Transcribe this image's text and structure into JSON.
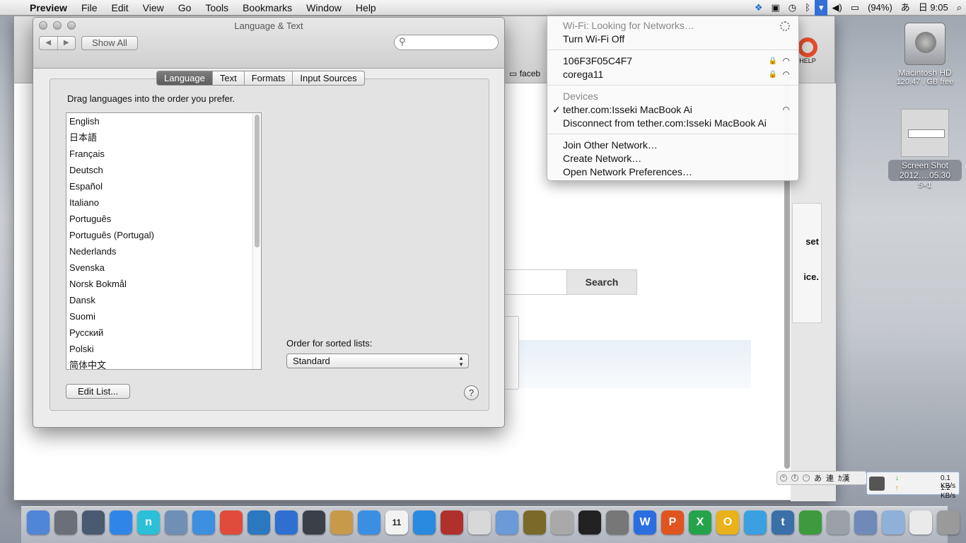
{
  "menubar": {
    "app_name": "Preview",
    "menus": [
      "File",
      "Edit",
      "View",
      "Go",
      "Tools",
      "Bookmarks",
      "Window",
      "Help"
    ],
    "battery": "(94%)",
    "ime": "あ",
    "clock": "日 9:05"
  },
  "desktop": {
    "hd_name": "Macintosh HD",
    "hd_free": "120.47 . GB free",
    "shot_name1": "Screen Shot",
    "shot_name2": "2012….05.30",
    "shot_dim": "5×1"
  },
  "browser": {
    "bookmark_folder": "faceb",
    "help_label": "HELP",
    "side_text1": "set",
    "side_text2": "ice.",
    "search_button": "Search"
  },
  "prefs": {
    "title": "Language & Text",
    "show_all": "Show All",
    "tabs": [
      "Language",
      "Text",
      "Formats",
      "Input Sources"
    ],
    "instructions": "Drag languages into the order you prefer.",
    "languages": [
      "English",
      "日本語",
      "Français",
      "Deutsch",
      "Español",
      "Italiano",
      "Português",
      "Português (Portugal)",
      "Nederlands",
      "Svenska",
      "Norsk Bokmål",
      "Dansk",
      "Suomi",
      "Русский",
      "Polski",
      "简体中文"
    ],
    "order_label": "Order for sorted lists:",
    "order_value": "Standard",
    "edit_list": "Edit List...",
    "help": "?"
  },
  "wifi_menu": {
    "status": "Wi-Fi: Looking for Networks…",
    "toggle": "Turn Wi-Fi Off",
    "networks": [
      "106F3F05C4F7",
      "corega11"
    ],
    "devices_header": "Devices",
    "device": "tether.com:Isseki MacBook Ai",
    "disconnect": "Disconnect from tether.com:Isseki MacBook Ai",
    "join_other": "Join Other Network…",
    "create": "Create Network…",
    "open_prefs": "Open Network Preferences…"
  },
  "ime_bar": {
    "label1": "あ",
    "label2": "連",
    "label3": "ｶ漢"
  },
  "net_widget": {
    "down": "0.1 KB/s",
    "up": "1.2 KB/s"
  },
  "dock_icons": [
    "finder-icon",
    "launchpad-icon",
    "activity-monitor-icon",
    "app-store-icon",
    "n-app-icon",
    "mail-icon",
    "safari-icon",
    "chrome-icon",
    "network-icon",
    "camera-icon",
    "facetime-icon",
    "address-book-icon",
    "dropbox-icon",
    "calendar-icon",
    "itunes-icon",
    "photo-booth-icon",
    "utility-icon",
    "preview-icon",
    "radar-icon",
    "doctor-icon",
    "terminal-icon",
    "system-preferences-icon",
    "word-icon",
    "powerpoint-icon",
    "excel-icon",
    "outlook-icon",
    "messenger-icon",
    "tumblr-icon",
    "downloader-icon",
    "virtual-machine-icon",
    "photos-icon",
    "folder-icon",
    "document-icon",
    "trash-icon"
  ],
  "colors": {
    "menu_highlight": "#3470d6",
    "tab_selected": "#6b6b6b"
  }
}
